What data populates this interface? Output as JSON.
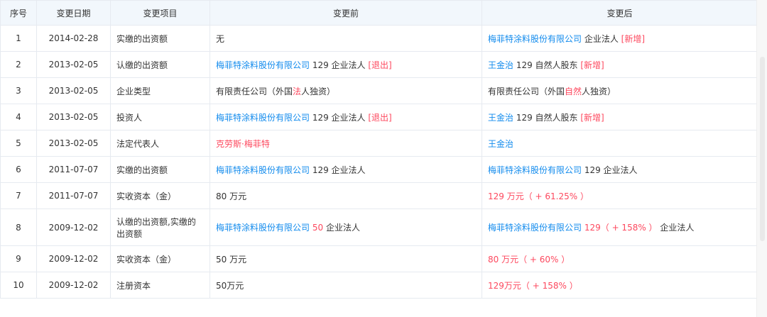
{
  "headers": [
    "序号",
    "变更日期",
    "变更项目",
    "变更前",
    "变更后"
  ],
  "rows": [
    {
      "no": "1",
      "date": "2014-02-28",
      "item": "实缴的出资额",
      "before": [
        {
          "t": "无"
        }
      ],
      "after": [
        {
          "t": "梅菲特涂料股份有限公司",
          "c": "blue"
        },
        {
          "t": " 企业法人 "
        },
        {
          "t": "[新增]",
          "c": "red"
        }
      ]
    },
    {
      "no": "2",
      "date": "2013-02-05",
      "item": "认缴的出资额",
      "before": [
        {
          "t": "梅菲特涂料股份有限公司",
          "c": "blue"
        },
        {
          "t": " 129 企业法人 "
        },
        {
          "t": "[退出]",
          "c": "red"
        }
      ],
      "after": [
        {
          "t": "王金治",
          "c": "blue"
        },
        {
          "t": " 129 自然人股东 "
        },
        {
          "t": "[新增]",
          "c": "red"
        }
      ]
    },
    {
      "no": "3",
      "date": "2013-02-05",
      "item": "企业类型",
      "before": [
        {
          "t": "有限责任公司（外国"
        },
        {
          "t": "法",
          "c": "red"
        },
        {
          "t": "人独资）"
        }
      ],
      "after": [
        {
          "t": "有限责任公司（外国"
        },
        {
          "t": "自然",
          "c": "red"
        },
        {
          "t": "人独资）"
        }
      ]
    },
    {
      "no": "4",
      "date": "2013-02-05",
      "item": "投资人",
      "before": [
        {
          "t": "梅菲特涂料股份有限公司",
          "c": "blue"
        },
        {
          "t": " 129 企业法人 "
        },
        {
          "t": "[退出]",
          "c": "red"
        }
      ],
      "after": [
        {
          "t": "王金治",
          "c": "blue"
        },
        {
          "t": " 129 自然人股东 "
        },
        {
          "t": "[新增]",
          "c": "red"
        }
      ]
    },
    {
      "no": "5",
      "date": "2013-02-05",
      "item": "法定代表人",
      "before": [
        {
          "t": "克劳斯·梅菲特",
          "c": "red"
        }
      ],
      "after": [
        {
          "t": "王金治",
          "c": "blue"
        }
      ]
    },
    {
      "no": "6",
      "date": "2011-07-07",
      "item": "实缴的出资额",
      "before": [
        {
          "t": "梅菲特涂料股份有限公司",
          "c": "blue"
        },
        {
          "t": " 129 企业法人"
        }
      ],
      "after": [
        {
          "t": "梅菲特涂料股份有限公司",
          "c": "blue"
        },
        {
          "t": " 129 企业法人"
        }
      ]
    },
    {
      "no": "7",
      "date": "2011-07-07",
      "item": "实收资本（金）",
      "before": [
        {
          "t": "80 万元"
        }
      ],
      "after": [
        {
          "t": "129 万元（ + 61.25% ）",
          "c": "red"
        }
      ]
    },
    {
      "no": "8",
      "date": "2009-12-02",
      "item": "认缴的出资额,实缴的出资额",
      "tall": true,
      "before": [
        {
          "t": "梅菲特涂料股份有限公司",
          "c": "blue"
        },
        {
          "t": " "
        },
        {
          "t": "50",
          "c": "red"
        },
        {
          "t": " 企业法人"
        }
      ],
      "after": [
        {
          "t": "梅菲特涂料股份有限公司",
          "c": "blue"
        },
        {
          "t": " "
        },
        {
          "t": "129（ + 158% ）",
          "c": "red"
        },
        {
          "t": " 企业法人"
        }
      ]
    },
    {
      "no": "9",
      "date": "2009-12-02",
      "item": "实收资本（金）",
      "before": [
        {
          "t": "50 万元"
        }
      ],
      "after": [
        {
          "t": "80 万元（ + 60% ）",
          "c": "red"
        }
      ]
    },
    {
      "no": "10",
      "date": "2009-12-02",
      "item": "注册资本",
      "before": [
        {
          "t": "50万元"
        }
      ],
      "after": [
        {
          "t": "129万元（ + 158% ）",
          "c": "red"
        }
      ]
    }
  ]
}
